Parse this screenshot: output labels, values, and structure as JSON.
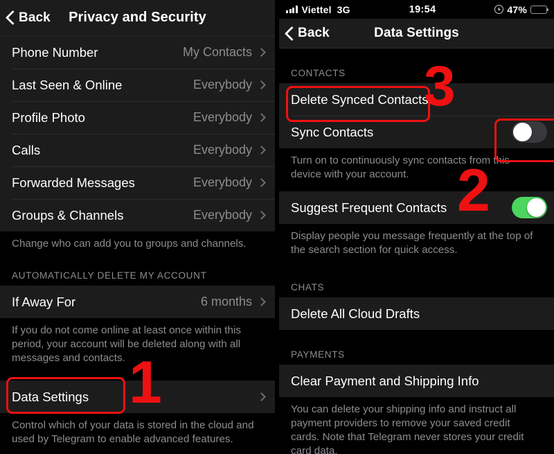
{
  "left_panel": {
    "nav": {
      "back_label": "Back",
      "title": "Privacy and Security"
    },
    "privacy_rows": [
      {
        "label": "Phone Number",
        "value": "My Contacts"
      },
      {
        "label": "Last Seen & Online",
        "value": "Everybody"
      },
      {
        "label": "Profile Photo",
        "value": "Everybody"
      },
      {
        "label": "Calls",
        "value": "Everybody"
      },
      {
        "label": "Forwarded Messages",
        "value": "Everybody"
      },
      {
        "label": "Groups & Channels",
        "value": "Everybody"
      }
    ],
    "privacy_footnote": "Change who can add you to groups and channels.",
    "auto_delete_header": "AUTOMATICALLY DELETE MY ACCOUNT",
    "auto_delete_row": {
      "label": "If Away For",
      "value": "6 months"
    },
    "auto_delete_footnote": "If you do not come online at least once within this period, your account will be deleted along with all messages and contacts.",
    "data_settings_row": {
      "label": "Data Settings"
    },
    "data_settings_footnote": "Control which of your data is stored in the cloud and used by Telegram to enable advanced features."
  },
  "right_panel": {
    "status_bar": {
      "carrier": "Viettel",
      "network_type": "3G",
      "time": "19:54",
      "battery_percent": "47%",
      "battery_level": 47,
      "battery_color": "#f8d534",
      "low_power_icon": "low-power-mode-icon",
      "signal_icon": "signal-bars-icon"
    },
    "nav": {
      "back_label": "Back",
      "title": "Data Settings"
    },
    "contacts_header": "CONTACTS",
    "delete_synced_row": {
      "label": "Delete Synced Contacts"
    },
    "sync_contacts_row": {
      "label": "Sync Contacts",
      "toggle_state": "off"
    },
    "sync_contacts_footnote": "Turn on to continuously sync contacts from this device with your account.",
    "suggest_frequent_row": {
      "label": "Suggest Frequent Contacts",
      "toggle_state": "on"
    },
    "suggest_frequent_footnote": "Display people you message frequently at the top of the search section for quick access.",
    "chats_header": "CHATS",
    "delete_drafts_row": {
      "label": "Delete All Cloud Drafts"
    },
    "payments_header": "PAYMENTS",
    "clear_payment_row": {
      "label": "Clear Payment and Shipping Info"
    },
    "payments_footnote": "You can delete your shipping info and instruct all payment providers to remove your saved credit cards. Note that Telegram never stores your credit card data."
  },
  "annotations": {
    "accent_color": "#ee1111",
    "step_1": "1",
    "step_2": "2",
    "step_3": "3"
  }
}
